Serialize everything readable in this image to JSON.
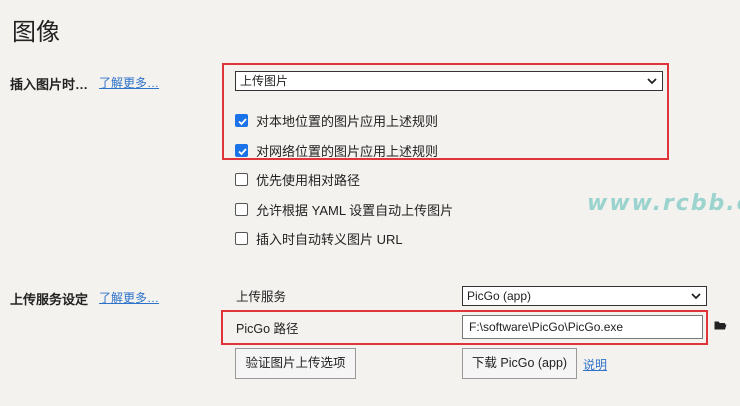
{
  "page": {
    "title": "图像"
  },
  "insert_section": {
    "label": "插入图片时…",
    "learn_more": "了解更多…",
    "select_value": "上传图片",
    "checkboxes": [
      {
        "label": "对本地位置的图片应用上述规则",
        "checked": true
      },
      {
        "label": "对网络位置的图片应用上述规则",
        "checked": true
      },
      {
        "label": "优先使用相对路径",
        "checked": false
      },
      {
        "label": "允许根据 YAML 设置自动上传图片",
        "checked": false
      },
      {
        "label": "插入时自动转义图片 URL",
        "checked": false
      }
    ]
  },
  "upload_section": {
    "label": "上传服务设定",
    "learn_more": "了解更多…",
    "service_label": "上传服务",
    "service_value": "PicGo (app)",
    "path_label": "PicGo 路径",
    "path_value": "F:\\software\\PicGo\\PicGo.exe",
    "verify_button": "验证图片上传选项",
    "download_button": "下载 PicGo (app)",
    "help_link": "说明"
  },
  "watermark": "www.rcbb.cc",
  "colors": {
    "highlight": "#e0343a",
    "link": "#2d73c9",
    "checkbox": "#1a73e8"
  }
}
